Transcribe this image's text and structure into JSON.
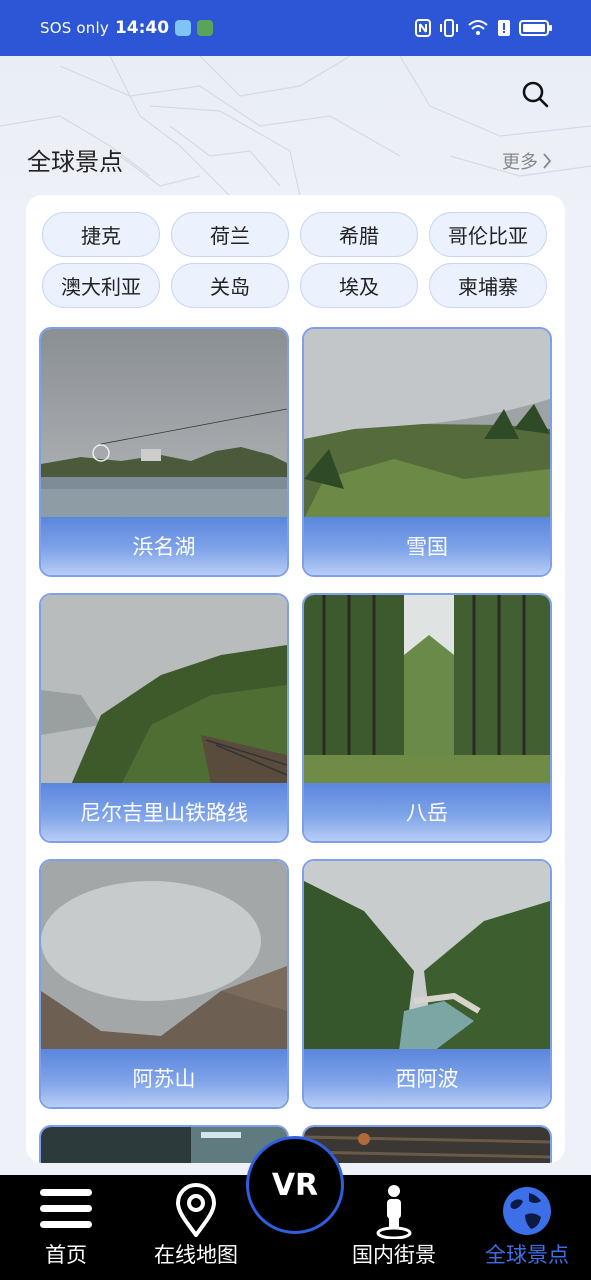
{
  "status_bar": {
    "carrier": "SOS only",
    "time": "14:40",
    "background": "#2c56d6"
  },
  "header": {
    "section_title": "全球景点",
    "more_label": "更多",
    "search_icon": "search-icon"
  },
  "chips": [
    "捷克",
    "荷兰",
    "希腊",
    "哥伦比亚",
    "澳大利亚",
    "关岛",
    "埃及",
    "柬埔寨"
  ],
  "scenic_spots": [
    {
      "name": "浜名湖"
    },
    {
      "name": "雪国"
    },
    {
      "name": "尼尔吉里山铁路线"
    },
    {
      "name": "八岳"
    },
    {
      "name": "阿苏山"
    },
    {
      "name": "西阿波"
    }
  ],
  "vr_button": "VR",
  "bottom_nav": [
    {
      "label": "首页",
      "icon": "menu-icon"
    },
    {
      "label": "在线地图",
      "icon": "location-pin-icon"
    },
    {
      "label": "国内街景",
      "icon": "person-pin-icon"
    },
    {
      "label": "全球景点",
      "icon": "globe-icon",
      "active": true
    }
  ],
  "colors": {
    "accent": "#2c56d6",
    "nav_active": "#3d6fe8",
    "chip_bg": "#ebf1fd"
  }
}
